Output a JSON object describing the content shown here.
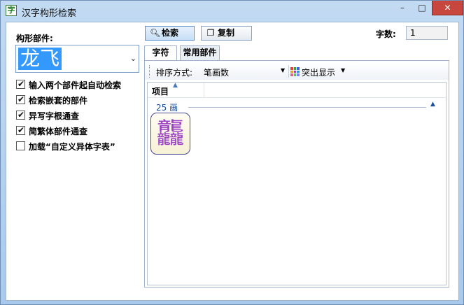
{
  "window": {
    "title": "汉字构形检索",
    "app_icon_glyph": "字",
    "minimize_glyph": "–",
    "maximize_glyph": "□",
    "close_glyph": "✕"
  },
  "left": {
    "components_label": "构形部件:",
    "components_value": "龙飞",
    "options": [
      {
        "label": "输入两个部件起自动检索",
        "checked": true
      },
      {
        "label": "检索嵌套的部件",
        "checked": true
      },
      {
        "label": "异写字根通查",
        "checked": true
      },
      {
        "label": "简繁体部件通查",
        "checked": true
      },
      {
        "label": "加载“自定义异体字表”",
        "checked": false
      }
    ]
  },
  "toolbar": {
    "search_label": "检索",
    "copy_label": "复制",
    "count_label": "字数:",
    "count_value": "1",
    "search_icon": "magnifier-icon",
    "copy_icon": "copy-icon"
  },
  "tabs": [
    {
      "label": "字符",
      "active": true
    },
    {
      "label": "常用部件",
      "active": false
    }
  ],
  "sortbar": {
    "sort_label": "排序方式:",
    "sort_value": "笔画数",
    "highlight_label": "突出显示",
    "highlight_colors": [
      "#e04040",
      "#40a040",
      "#4060e0",
      "#e0a020",
      "#a040c0",
      "#20a0c0",
      "#e06090",
      "#60c060",
      "#8080ff"
    ]
  },
  "list": {
    "column_header": "项目",
    "group_label": "25 画",
    "items": [
      {
        "char": "龘"
      }
    ]
  }
}
